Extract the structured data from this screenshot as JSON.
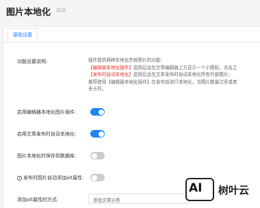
{
  "header": {
    "title": "图片本地化",
    "subtitle": "加油"
  },
  "tabs": [
    {
      "label": "基础设置",
      "active": true
    }
  ],
  "settings": {
    "description_label": "功能设置说明:",
    "description_line1": "插件提供两种本地化外部图片的功能:",
    "description_line2_red": "【编辑器本地化插件】",
    "description_line2_rest": "启用后会在文章编辑器上方显示一个小图标，点击之",
    "description_line3_red": "【发布时自动本地化】",
    "description_line3_rest": "启用后会在文章发布时自动本地化所有外部图片;",
    "description_line4": "推荐使用【编辑器本地化插件】在发布前进行本地化，当图片数量过多或者",
    "description_line5": "丢卡死。",
    "editor_plugin_label": "启用编辑器本地化图片插件:",
    "editor_plugin_on": true,
    "auto_localize_label": "启用文章发布时自动本地化:",
    "auto_localize_on": true,
    "save_to_media_label": "图片本地化时保存到数据库:",
    "save_to_media_on": false,
    "alt_attr_label": "发布时图片自动添加alt属性:",
    "alt_attr_on": false,
    "alt_method_label": "添加alt属性的方式:",
    "alt_method_value": "添加文章分类"
  },
  "watermark": {
    "logo_text": "AI",
    "brand_text": "树叶云"
  },
  "colors": {
    "accent": "#1e87f0",
    "toggle_off": "#cccccc",
    "highlight_red": "#e2352c"
  }
}
